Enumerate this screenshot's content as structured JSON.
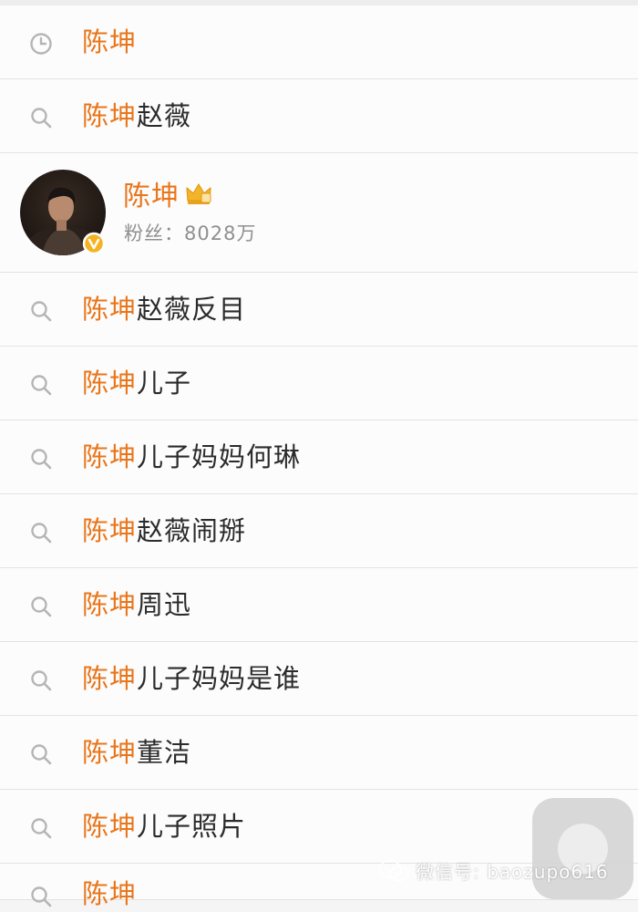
{
  "history": {
    "keyword": "陈坤",
    "rest": ""
  },
  "suggestions_top": [
    {
      "keyword": "陈坤",
      "rest": "赵薇"
    }
  ],
  "user": {
    "name": "陈坤",
    "fans_label": "粉丝：",
    "fans_count": "8028万",
    "verified": true,
    "crown_badge": true
  },
  "suggestions": [
    {
      "keyword": "陈坤",
      "rest": "赵薇反目"
    },
    {
      "keyword": "陈坤",
      "rest": "儿子"
    },
    {
      "keyword": "陈坤",
      "rest": "儿子妈妈何琳"
    },
    {
      "keyword": "陈坤",
      "rest": "赵薇闹掰"
    },
    {
      "keyword": "陈坤",
      "rest": "周迅"
    },
    {
      "keyword": "陈坤",
      "rest": "儿子妈妈是谁"
    },
    {
      "keyword": "陈坤",
      "rest": "董洁"
    },
    {
      "keyword": "陈坤",
      "rest": "儿子照片"
    },
    {
      "keyword": "陈坤",
      "rest": ""
    }
  ],
  "watermark": {
    "text": "微信号: baozupo616"
  },
  "icons": {
    "history": "clock-icon",
    "suggestion": "search-icon",
    "verified": "verified-badge-icon",
    "crown": "crown-icon",
    "watermark": "wechat-logo-icon"
  },
  "colors": {
    "keyword": "#e8761b",
    "text": "#2b2b2b",
    "secondary": "#8f8f8f",
    "icon": "#b5b5b5",
    "verified": "#f5b324",
    "crown": "#f2b52a",
    "divider": "#e4e3e3",
    "row_background": "#fdfcfc"
  }
}
